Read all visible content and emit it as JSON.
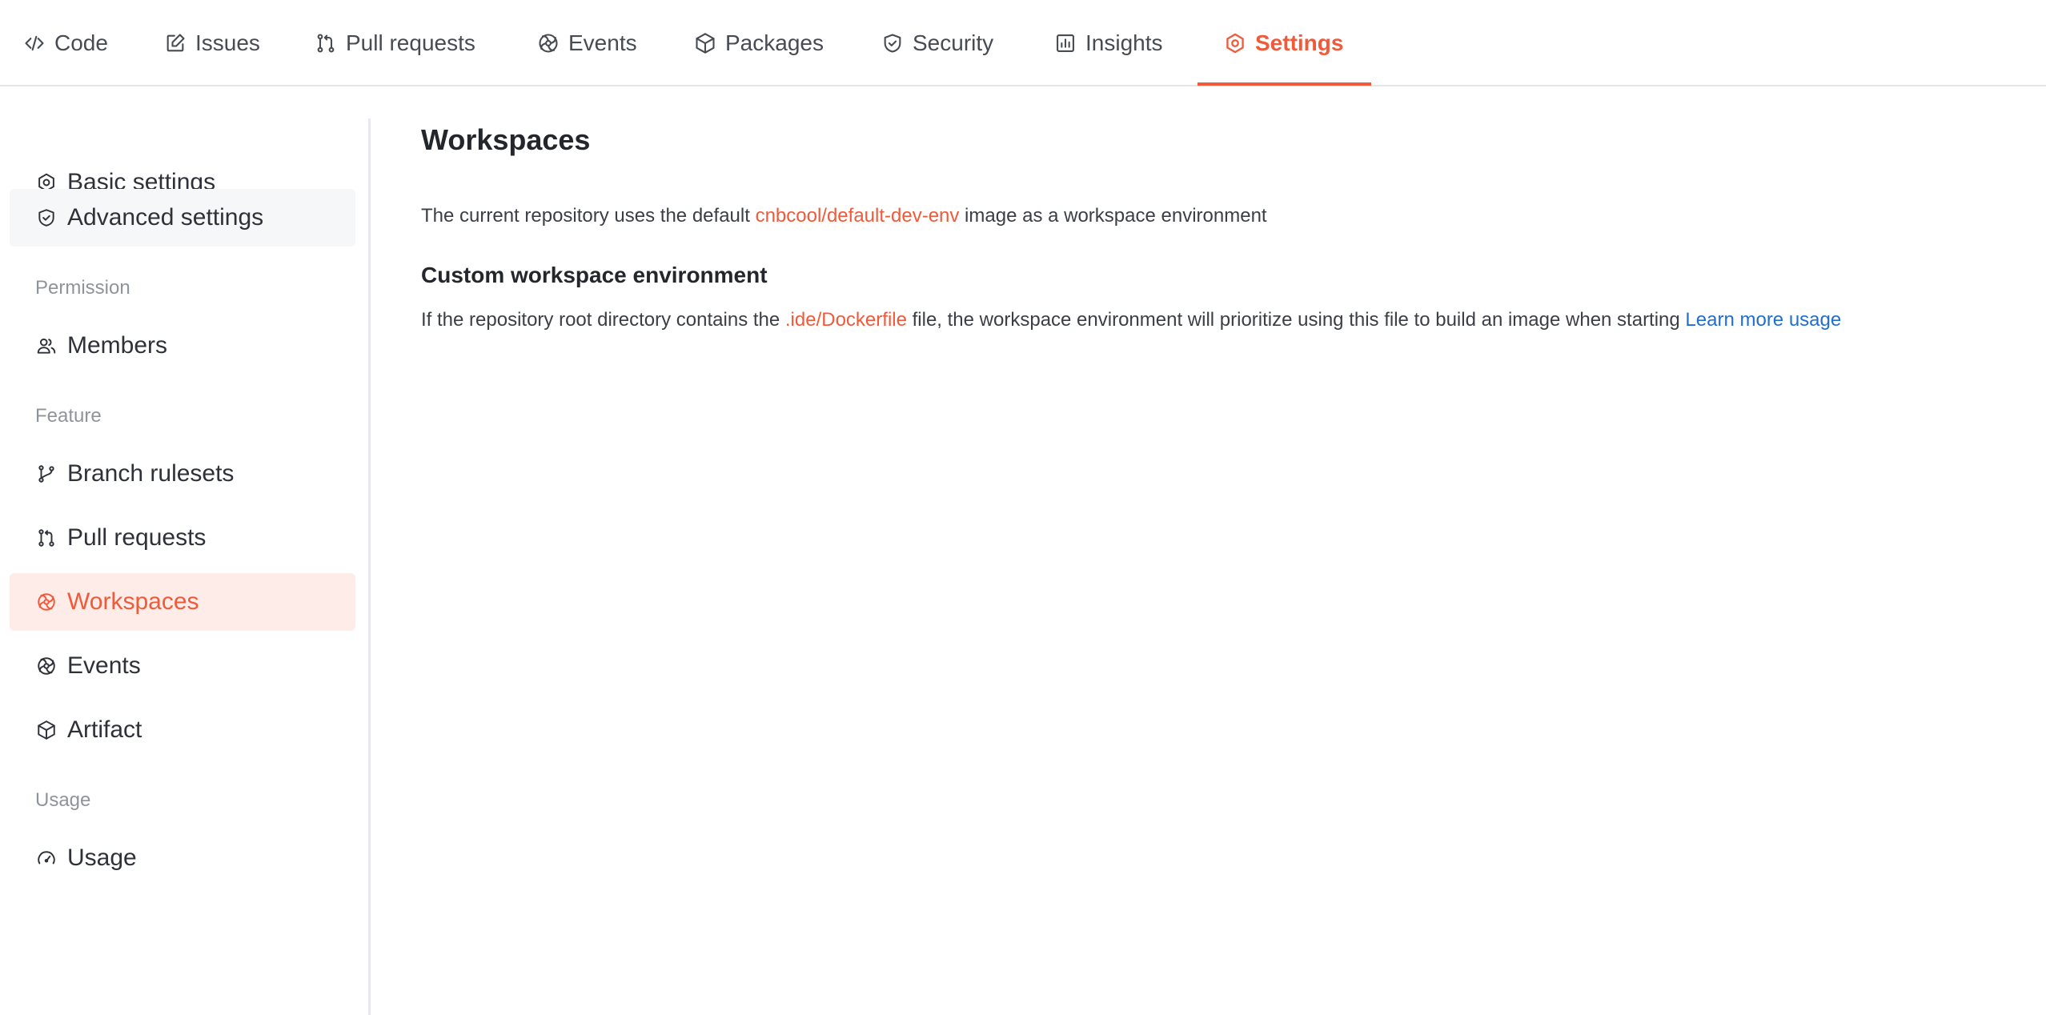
{
  "colors": {
    "accent": "#f05a3a",
    "link": "#1f6fd1",
    "active_bg": "#fdece7"
  },
  "topnav": {
    "tabs": [
      {
        "label": "Code",
        "icon": "code-icon"
      },
      {
        "label": "Issues",
        "icon": "issue-edit-icon"
      },
      {
        "label": "Pull requests",
        "icon": "pull-request-icon"
      },
      {
        "label": "Events",
        "icon": "events-icon"
      },
      {
        "label": "Packages",
        "icon": "package-icon"
      },
      {
        "label": "Security",
        "icon": "shield-icon"
      },
      {
        "label": "Insights",
        "icon": "bar-chart-icon"
      },
      {
        "label": "Settings",
        "icon": "gear-icon"
      }
    ],
    "active_tab": "Settings"
  },
  "sidebar": {
    "items": [
      {
        "label": "Basic settings",
        "icon": "gear-icon"
      },
      {
        "label": "Advanced settings",
        "icon": "shield-icon"
      },
      {
        "label": "Members",
        "icon": "members-icon"
      },
      {
        "label": "Branch rulesets",
        "icon": "branch-icon"
      },
      {
        "label": "Pull requests",
        "icon": "pull-request-icon"
      },
      {
        "label": "Workspaces",
        "icon": "workspaces-icon"
      },
      {
        "label": "Events",
        "icon": "events-icon"
      },
      {
        "label": "Artifact",
        "icon": "package-icon"
      },
      {
        "label": "Usage",
        "icon": "gauge-icon"
      }
    ],
    "groups": {
      "permission": "Permission",
      "feature": "Feature",
      "usage": "Usage"
    },
    "active_item": "Workspaces"
  },
  "main": {
    "title": "Workspaces",
    "desc1": {
      "before": "The current repository uses the default ",
      "highlight": "cnbcool/default-dev-env",
      "after": " image as a workspace environment"
    },
    "subtitle": "Custom workspace environment",
    "desc2": {
      "before": "If the repository root directory contains the ",
      "highlight": ".ide/Dockerfile",
      "after": " file, the workspace environment will prioritize using this file to build an image when starting ",
      "link": "Learn more usage"
    }
  }
}
